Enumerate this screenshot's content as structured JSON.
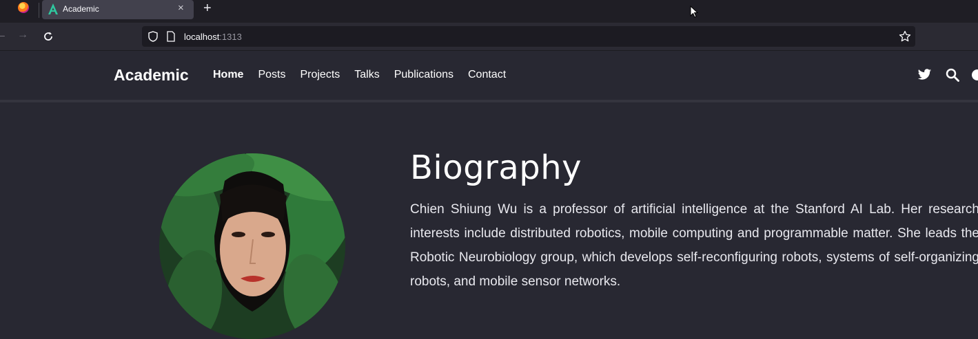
{
  "browser": {
    "tab_title": "Academic",
    "url_host": "localhost",
    "url_port": ":1313",
    "new_tab_glyph": "+",
    "close_glyph": "×",
    "back_glyph": "←",
    "forward_glyph": "→"
  },
  "site": {
    "brand": "Academic",
    "nav": [
      "Home",
      "Posts",
      "Projects",
      "Talks",
      "Publications",
      "Contact"
    ],
    "active_nav": "Home",
    "icons": [
      "twitter-icon",
      "search-icon",
      "moon-icon"
    ]
  },
  "biography": {
    "heading": "Biography",
    "text": "Chien Shiung Wu is a professor of artificial intelligence at the Stanford AI Lab. Her research interests include distributed robotics, mobile computing and programmable matter. She leads the Robotic Neurobiology group, which develops self-reconfiguring robots, systems of self-organizing robots, and mobile sensor networks."
  },
  "colors": {
    "page_bg": "#282832",
    "chrome_bg": "#1f1e25",
    "toolbar_bg": "#2b2a33",
    "urlbar_bg": "#1c1b22",
    "accent_tab_icon": "#2fc8a0"
  }
}
